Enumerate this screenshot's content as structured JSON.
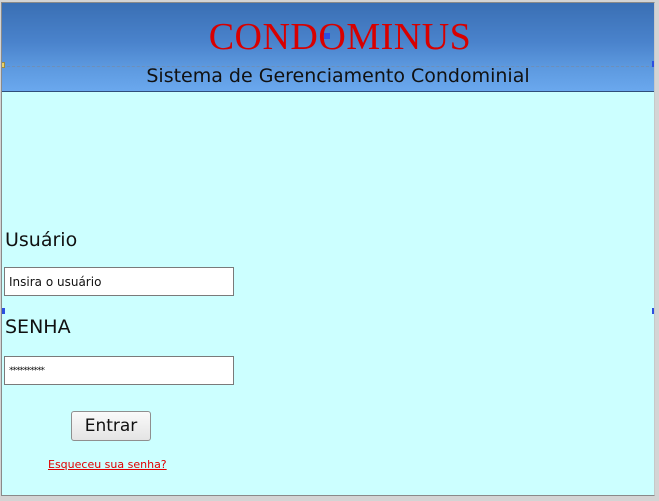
{
  "header": {
    "title": "CONDOMINUS",
    "subtitle": "Sistema de Gerenciamento Condominial"
  },
  "login": {
    "user_label": "Usuário",
    "user_value": "Insira o usuário",
    "password_label": "SENHA",
    "password_value": "**********",
    "submit_label": "Entrar",
    "forgot_link": "Esqueceu sua senha?"
  },
  "colors": {
    "title": "#d80000",
    "background": "#ccffff",
    "header_gradient_top": "#3a6fb4",
    "header_gradient_bottom": "#6aa8ee",
    "link": "#e00000"
  }
}
